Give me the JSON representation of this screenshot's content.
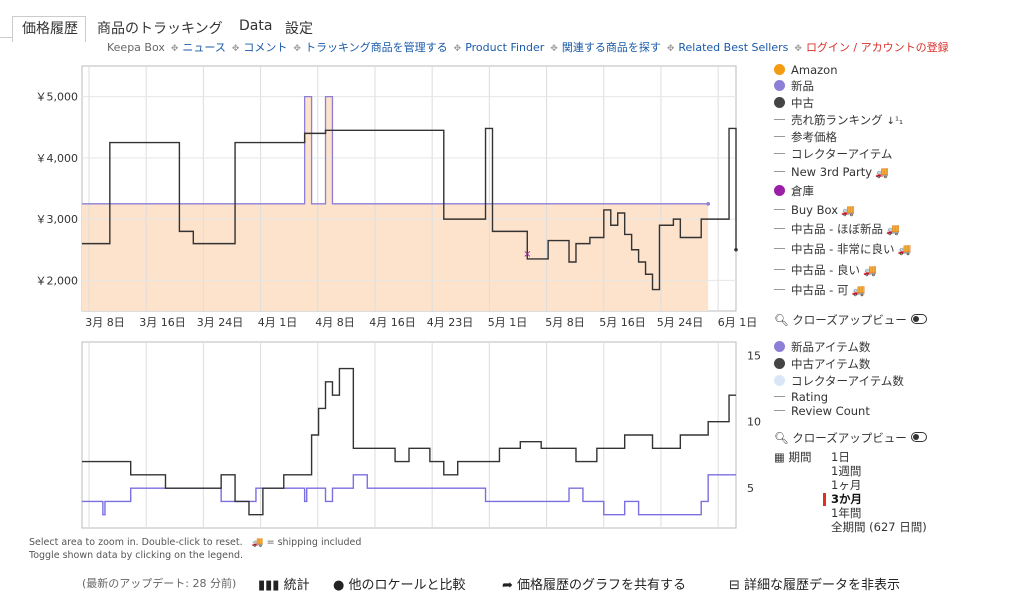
{
  "tabs": [
    {
      "label": "価格履歴",
      "active": true
    },
    {
      "label": "商品のトラッキング"
    },
    {
      "label": "Data"
    },
    {
      "label": "設定"
    }
  ],
  "nav": {
    "items": [
      "Keepa Box",
      "ニュース",
      "コメント",
      "トラッキング商品を管理する",
      "Product Finder",
      "関連する商品を探す",
      "Related Best Sellers",
      "ログイン / アカウントの登録"
    ]
  },
  "legend_top": [
    {
      "label": "Amazon",
      "color": "#f39c12",
      "marker": "dot"
    },
    {
      "label": "新品",
      "color": "#8e7fd6",
      "marker": "dot"
    },
    {
      "label": "中古",
      "color": "#444444",
      "marker": "dot"
    },
    {
      "label": "売れ筋ランキング",
      "marker": "dash",
      "suffix": "↓¹₁"
    },
    {
      "label": "参考価格",
      "marker": "dash"
    },
    {
      "label": "コレクターアイテム",
      "marker": "dash"
    },
    {
      "label": "New 3rd Party",
      "marker": "dash",
      "truck": true
    },
    {
      "label": "倉庫",
      "color": "#9b1fa6",
      "marker": "dot"
    },
    {
      "label": "Buy Box",
      "marker": "dash",
      "truck": true
    },
    {
      "label": "中古品 - ほぼ新品",
      "marker": "dash",
      "truck": true
    },
    {
      "label": "中古品 - 非常に良い",
      "marker": "dash",
      "truck": true
    },
    {
      "label": "中古品 - 良い",
      "marker": "dash",
      "truck": true
    },
    {
      "label": "中古品 - 可",
      "marker": "dash",
      "truck": true
    }
  ],
  "closeup_label": "クローズアップビュー",
  "legend_bottom": [
    {
      "label": "新品アイテム数",
      "color": "#8e7fd6",
      "marker": "dot"
    },
    {
      "label": "中古アイテム数",
      "color": "#444444",
      "marker": "dot"
    },
    {
      "label": "コレクターアイテム数",
      "color": "#d9e6f7",
      "marker": "dot"
    },
    {
      "label": "Rating",
      "marker": "dash"
    },
    {
      "label": "Review Count",
      "marker": "dash"
    }
  ],
  "range": {
    "label": "期間",
    "options": [
      "1日",
      "1週間",
      "1ヶ月",
      "3か月",
      "1年間",
      "全期間 (627 日間)"
    ],
    "selected": "3か月"
  },
  "help_text": {
    "line1": "Select area to zoom in. Double-click to reset.",
    "shipping": "= shipping included",
    "line2": "Toggle shown data by clicking on the legend."
  },
  "footer": {
    "last_update": "(最新のアップデート: 28 分前)",
    "stats": "統計",
    "compare": "他のロケールと比較",
    "share": "価格履歴のグラフを共有する",
    "hide": "詳細な履歴データを非表示"
  },
  "chart_data": [
    {
      "type": "line",
      "y_tick_labels": [
        "￥5,000",
        "￥4,000",
        "￥3,000",
        "￥2,000"
      ],
      "ylim": [
        1500,
        5500
      ],
      "x_tick_labels": [
        "3月 8日",
        "3月 16日",
        "3月 24日",
        "4月 1日",
        "4月 8日",
        "4月 16日",
        "4月 23日",
        "5月 1日",
        "5月 8日",
        "5月 16日",
        "5月 24日",
        "6月 1日"
      ],
      "series": [
        {
          "name": "新品",
          "color": "#8e7fd6",
          "points": [
            [
              0,
              3250
            ],
            [
              32,
              3250
            ],
            [
              32,
              5000
            ],
            [
              33,
              5000
            ],
            [
              33,
              3250
            ],
            [
              35,
              3250
            ],
            [
              35,
              5000
            ],
            [
              36,
              5000
            ],
            [
              36,
              3250
            ],
            [
              90,
              3250
            ]
          ]
        },
        {
          "name": "中古",
          "color": "#333333",
          "points": [
            [
              0,
              2600
            ],
            [
              4,
              2600
            ],
            [
              4,
              4250
            ],
            [
              14,
              4250
            ],
            [
              14,
              2800
            ],
            [
              16,
              2800
            ],
            [
              16,
              2600
            ],
            [
              22,
              2600
            ],
            [
              22,
              4250
            ],
            [
              32,
              4250
            ],
            [
              32,
              4400
            ],
            [
              35,
              4400
            ],
            [
              35,
              4450
            ],
            [
              52,
              4450
            ],
            [
              52,
              3000
            ],
            [
              58,
              3000
            ],
            [
              58,
              4480
            ],
            [
              59,
              4480
            ],
            [
              59,
              2800
            ],
            [
              64,
              2800
            ],
            [
              64,
              2350
            ],
            [
              67,
              2350
            ],
            [
              67,
              2650
            ],
            [
              70,
              2650
            ],
            [
              70,
              2300
            ],
            [
              71,
              2300
            ],
            [
              71,
              2600
            ],
            [
              73,
              2600
            ],
            [
              73,
              2700
            ],
            [
              75,
              2700
            ],
            [
              75,
              3150
            ],
            [
              76,
              3150
            ],
            [
              76,
              2900
            ],
            [
              77,
              2900
            ],
            [
              77,
              3100
            ],
            [
              78,
              3100
            ],
            [
              78,
              2750
            ],
            [
              79,
              2750
            ],
            [
              79,
              2500
            ],
            [
              80,
              2500
            ],
            [
              80,
              2300
            ],
            [
              81,
              2300
            ],
            [
              81,
              2100
            ],
            [
              82,
              2100
            ],
            [
              82,
              1850
            ],
            [
              83,
              1850
            ],
            [
              83,
              2900
            ],
            [
              85,
              2900
            ],
            [
              85,
              3000
            ],
            [
              86,
              3000
            ],
            [
              86,
              2700
            ],
            [
              89,
              2700
            ],
            [
              89,
              3000
            ],
            [
              93,
              3000
            ],
            [
              93,
              4480
            ],
            [
              94,
              4480
            ],
            [
              94,
              2500
            ]
          ]
        }
      ],
      "markers": [
        {
          "name": "倉庫",
          "x": 64,
          "y": 2450,
          "color": "#9b1fa6"
        }
      ],
      "x_domain": [
        0,
        94
      ],
      "shaded_area": "新品"
    },
    {
      "type": "line",
      "y_tick_labels": [
        "15",
        "10",
        "5"
      ],
      "ylim": [
        2,
        16
      ],
      "x_domain": [
        0,
        94
      ],
      "series": [
        {
          "name": "新品アイテム数",
          "color": "#7a6fe0",
          "points": [
            [
              0,
              4
            ],
            [
              3,
              4
            ],
            [
              3,
              3
            ],
            [
              3.3,
              3
            ],
            [
              3.3,
              4
            ],
            [
              7,
              4
            ],
            [
              7,
              5
            ],
            [
              20,
              5
            ],
            [
              20,
              4
            ],
            [
              25,
              4
            ],
            [
              25,
              5
            ],
            [
              32,
              5
            ],
            [
              32,
              4
            ],
            [
              32.3,
              4
            ],
            [
              32.3,
              5
            ],
            [
              35,
              5
            ],
            [
              35,
              4
            ],
            [
              36,
              4
            ],
            [
              36,
              5
            ],
            [
              39,
              5
            ],
            [
              39,
              6
            ],
            [
              41,
              6
            ],
            [
              41,
              5
            ],
            [
              58,
              5
            ],
            [
              58,
              4
            ],
            [
              70,
              4
            ],
            [
              70,
              5
            ],
            [
              72,
              5
            ],
            [
              72,
              4
            ],
            [
              75,
              4
            ],
            [
              75,
              3
            ],
            [
              78,
              3
            ],
            [
              78,
              4
            ],
            [
              80,
              4
            ],
            [
              80,
              3
            ],
            [
              89,
              3
            ],
            [
              89,
              4
            ],
            [
              90,
              4
            ],
            [
              90,
              6
            ],
            [
              94,
              6
            ]
          ]
        },
        {
          "name": "中古アイテム数",
          "color": "#333333",
          "points": [
            [
              0,
              7
            ],
            [
              7,
              7
            ],
            [
              7,
              6
            ],
            [
              12,
              6
            ],
            [
              12,
              5
            ],
            [
              20,
              5
            ],
            [
              20,
              6
            ],
            [
              22,
              6
            ],
            [
              22,
              4
            ],
            [
              24,
              4
            ],
            [
              24,
              3
            ],
            [
              26,
              3
            ],
            [
              26,
              5
            ],
            [
              29,
              5
            ],
            [
              29,
              6
            ],
            [
              33,
              6
            ],
            [
              33,
              9
            ],
            [
              34,
              9
            ],
            [
              34,
              11
            ],
            [
              35,
              11
            ],
            [
              35,
              13
            ],
            [
              36,
              13
            ],
            [
              36,
              12
            ],
            [
              37,
              12
            ],
            [
              37,
              14
            ],
            [
              39,
              14
            ],
            [
              39,
              8
            ],
            [
              45,
              8
            ],
            [
              45,
              7
            ],
            [
              47,
              7
            ],
            [
              47,
              8
            ],
            [
              50,
              8
            ],
            [
              50,
              7
            ],
            [
              52,
              7
            ],
            [
              52,
              6
            ],
            [
              54,
              6
            ],
            [
              54,
              7
            ],
            [
              60,
              7
            ],
            [
              60,
              8
            ],
            [
              63,
              8
            ],
            [
              63,
              8.5
            ],
            [
              66,
              8.5
            ],
            [
              66,
              8
            ],
            [
              71,
              8
            ],
            [
              71,
              7
            ],
            [
              74,
              7
            ],
            [
              74,
              8
            ],
            [
              78,
              8
            ],
            [
              78,
              9
            ],
            [
              82,
              9
            ],
            [
              82,
              8
            ],
            [
              86,
              8
            ],
            [
              86,
              9
            ],
            [
              90,
              9
            ],
            [
              90,
              10
            ],
            [
              93,
              10
            ],
            [
              93,
              12
            ],
            [
              94,
              12
            ]
          ]
        }
      ]
    }
  ]
}
